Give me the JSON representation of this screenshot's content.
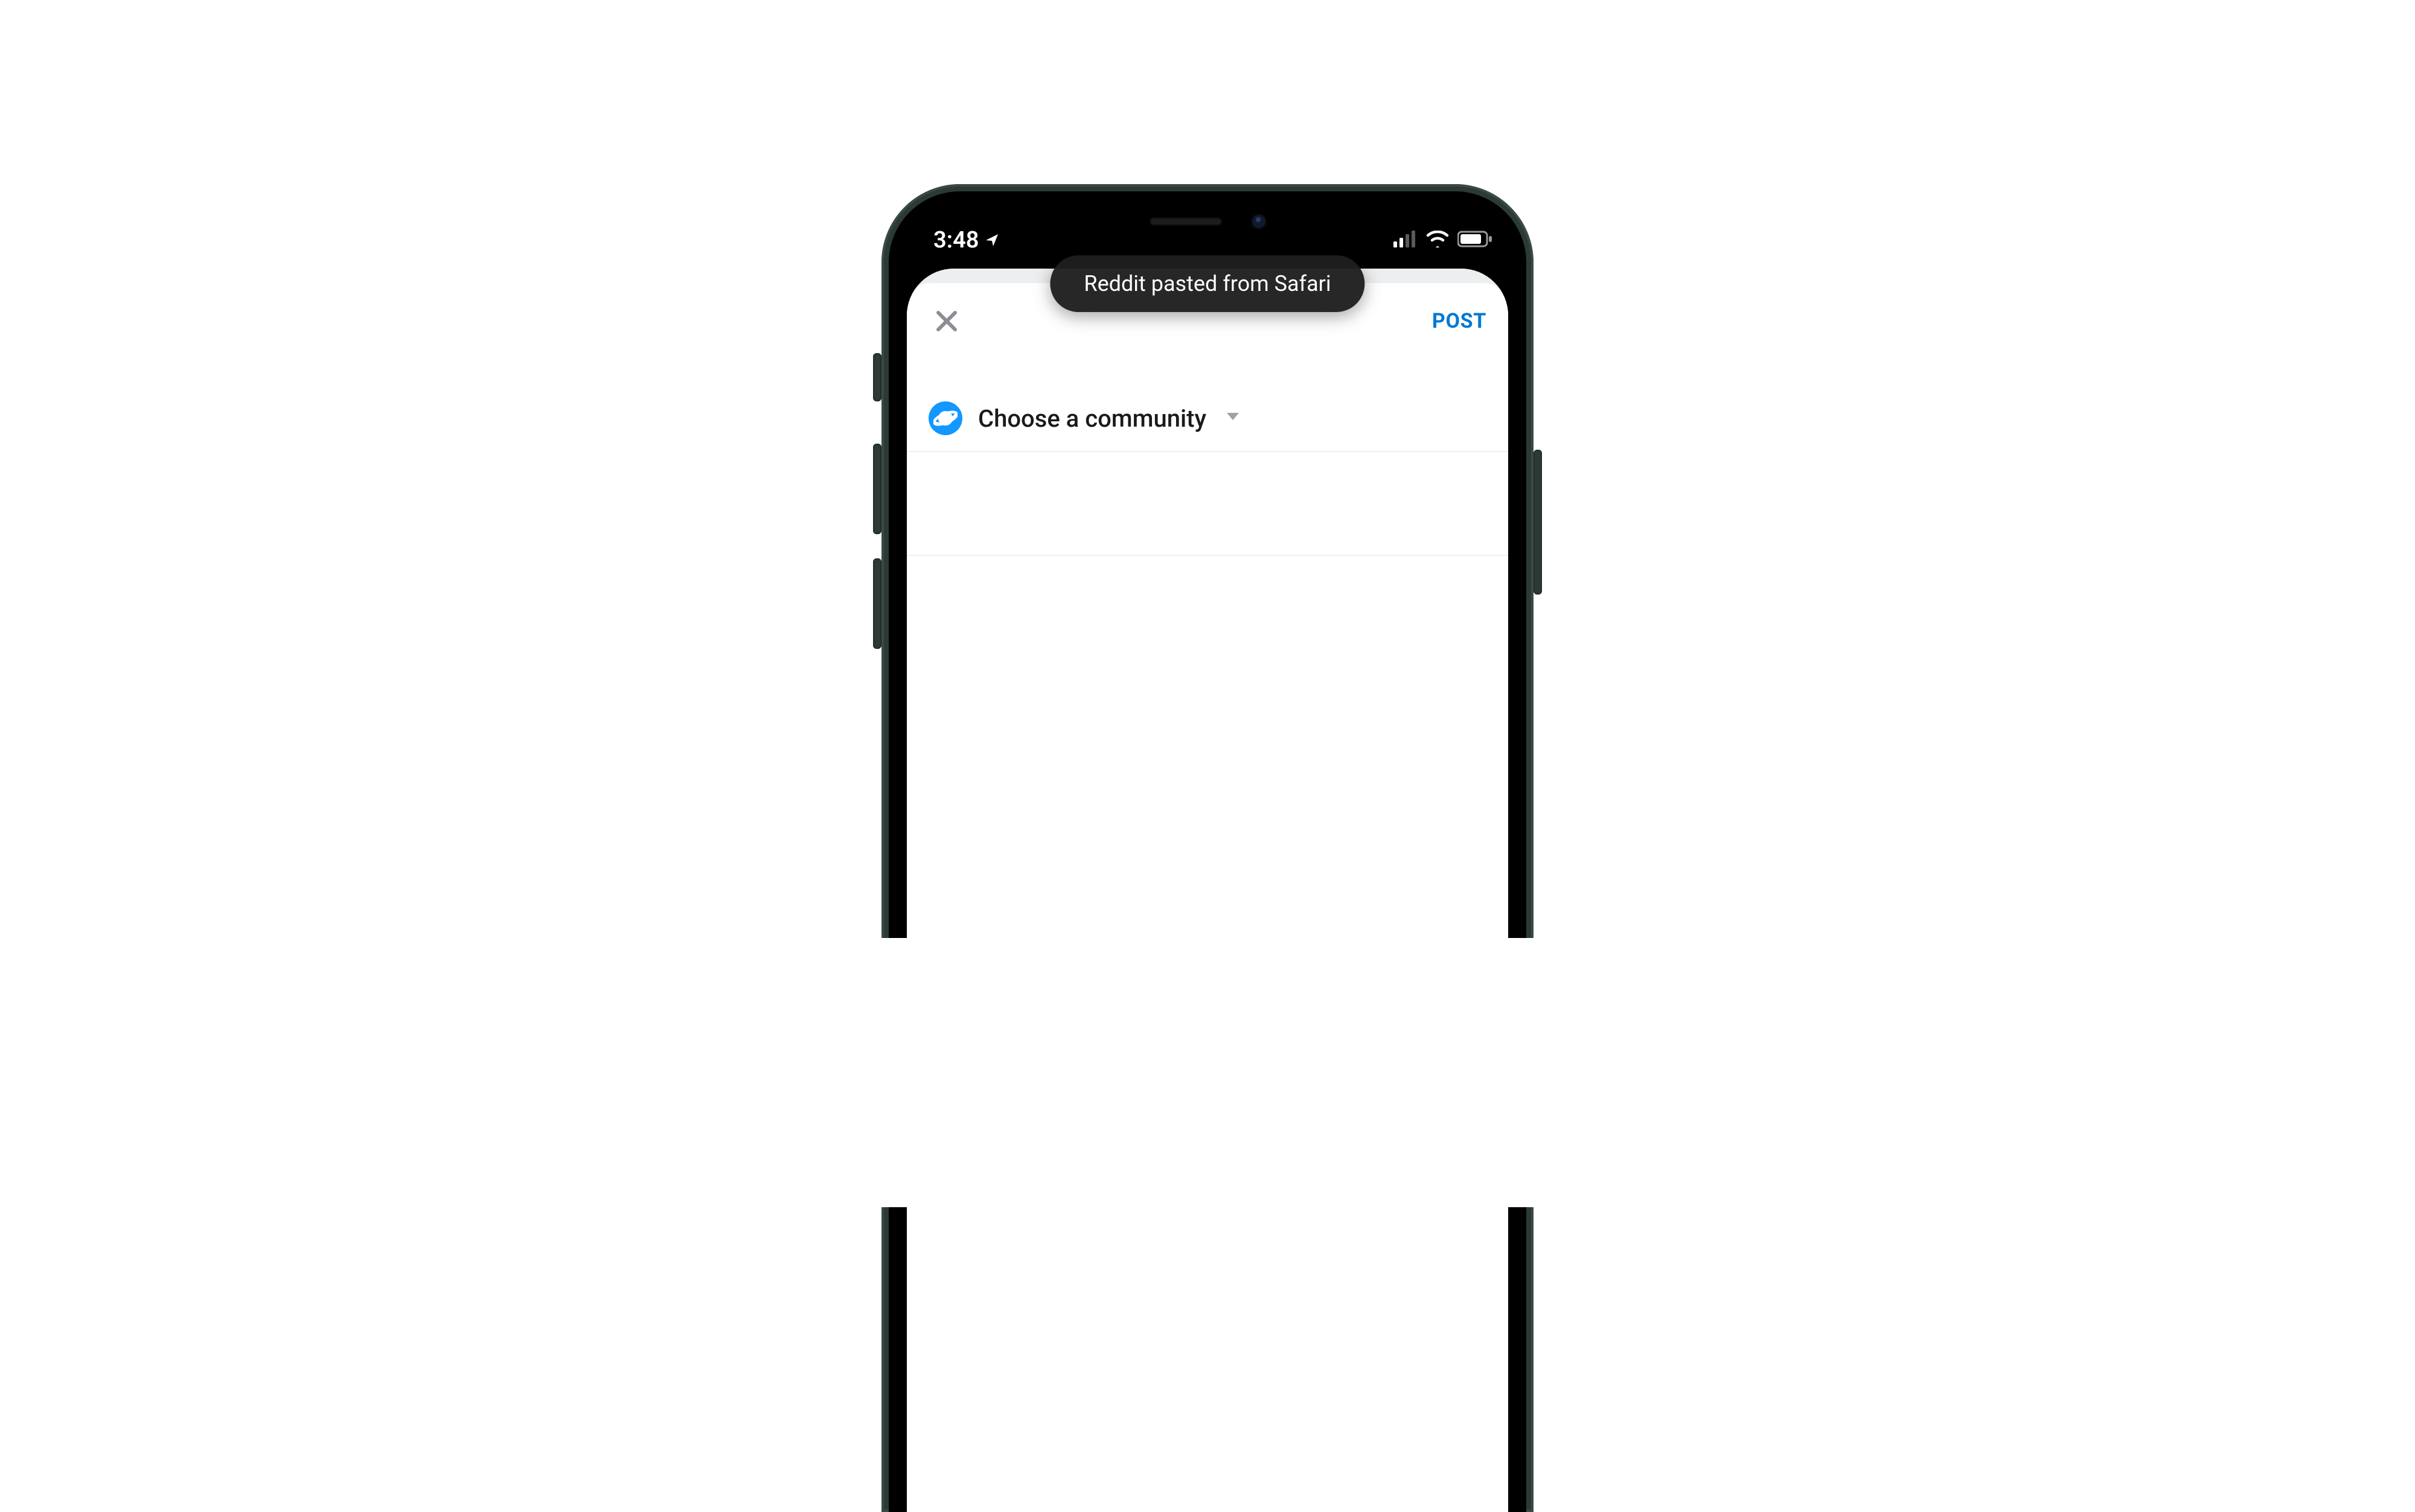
{
  "status": {
    "time": "3:48"
  },
  "toast": {
    "message": "Reddit pasted from Safari"
  },
  "nav": {
    "post_label": "POST"
  },
  "community": {
    "label": "Choose a community"
  }
}
